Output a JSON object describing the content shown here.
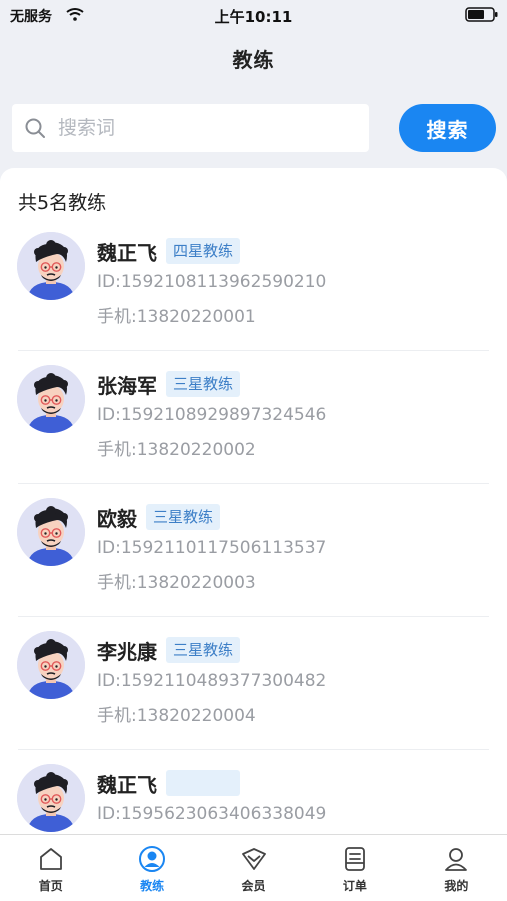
{
  "status_bar": {
    "carrier": "无服务",
    "time": "上午10:11"
  },
  "nav": {
    "title": "教练"
  },
  "search": {
    "placeholder": "搜索词",
    "value": "",
    "button_label": "搜索"
  },
  "list": {
    "count_text": "共5名教练",
    "coaches": [
      {
        "name": "魏正飞",
        "badge": "四星教练",
        "id": "ID:1592108113962590210",
        "phone": "手机:13820220001"
      },
      {
        "name": "张海军",
        "badge": "三星教练",
        "id": "ID:1592108929897324546",
        "phone": "手机:13820220002"
      },
      {
        "name": "欧毅",
        "badge": "三星教练",
        "id": "ID:1592110117506113537",
        "phone": "手机:13820220003"
      },
      {
        "name": "李兆康",
        "badge": "三星教练",
        "id": "ID:1592110489377300482",
        "phone": "手机:13820220004"
      },
      {
        "name": "魏正飞",
        "badge": "",
        "id": "ID:1595623063406338049",
        "phone": ""
      }
    ]
  },
  "tabbar": {
    "tabs": [
      {
        "label": "首页",
        "icon": "home-icon"
      },
      {
        "label": "教练",
        "icon": "coach-icon",
        "active": true
      },
      {
        "label": "会员",
        "icon": "member-icon"
      },
      {
        "label": "订单",
        "icon": "order-icon"
      },
      {
        "label": "我的",
        "icon": "profile-icon"
      }
    ]
  },
  "colors": {
    "accent": "#1a86f2",
    "badge_bg": "#e4f0fb",
    "badge_text": "#3d7fc7"
  }
}
